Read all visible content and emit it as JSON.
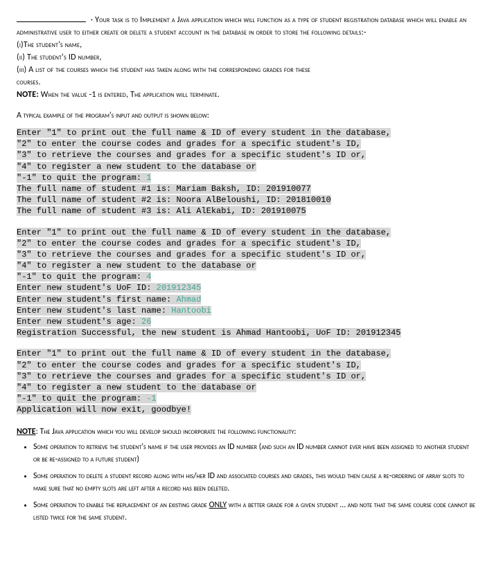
{
  "intro": {
    "line1_part1": "· Your task is to Implement a Java application which will function as a",
    "line2": "type of student registration database which will enable an administrative user to either create or delete a",
    "line3": "student account in the database in order to store the following details:-",
    "item1": "(i)The student's name,",
    "item2": "(ii) The student's ID number,",
    "item3": "(iii) A list of the courses which the student has taken along with the corresponding grades for these",
    "item3b": "courses.",
    "note_label": "NOTE:",
    "note_text": " When the value -1 is entered, The application will terminate."
  },
  "example_heading": "A typical example of the program's input and output is shown below:",
  "block1": {
    "l1": "Enter \"1\" to print out the full name & ID of every student in the database,",
    "l2": "\"2\" to enter the course codes and grades for a specific student's ID,",
    "l3": "\"3\" to retrieve the courses and grades for a specific student's ID or,",
    "l4": "\"4\" to register a new student to the database or",
    "l5a": "\"-1\" to quit the program: ",
    "l5b": "1",
    "l6": "The full name of student #1 is: Mariam Baksh, ID: 201910077",
    "l7": "The full name of student #2 is: Noora AlBeloushi, ID: 201810010",
    "l8": "The full name of student #3 is: Ali AlEkabi, ID: 201910075"
  },
  "block2": {
    "l1": "Enter \"1\" to print out the full name & ID of every student in the database,",
    "l2": "\"2\" to enter the course codes and grades for a specific student's ID,",
    "l3": "\"3\" to retrieve the courses and grades for a specific student's ID or,",
    "l4": "\"4\" to register a new student to the database or",
    "l5a": "\"-1\" to quit the program: ",
    "l5b": "4",
    "l6a": "Enter new student's UoF ID: ",
    "l6b": "201912345",
    "l7a": "Enter new student's first name: ",
    "l7b": "Ahmad",
    "l8a": "Enter new student's last name: ",
    "l8b": "Hantoobi",
    "l9a": "Enter new student's age: ",
    "l9b": "26",
    "l10": "Registration Successful, the new student is Ahmad Hantoobi, UoF ID: 201912345"
  },
  "block3": {
    "l1": "Enter \"1\" to print out the full name & ID of every student in the database,",
    "l2": "\"2\" to enter the course codes and grades for a specific student's ID,",
    "l3": "\"3\" to retrieve the courses and grades for a specific student's ID or,",
    "l4": "\"4\" to register a new student to the database or",
    "l5a": "\"-1\" to quit the program: ",
    "l5b": "-1",
    "l6": "Application will now exit, goodbye!"
  },
  "func": {
    "note_label": "NOTE",
    "note_rest": ": The Java application which you will develop should incorporate the following functionality:",
    "b1": "Some operation to retrieve the student's name if the user provides an ID number (and such an ID number cannot ever have been assigned to another student or be re-assigned to a future student)",
    "b2": "Some operation to delete a student record along with his/her ID and associated courses and grades, this would then cause a re-ordering of array slots to make sure that no empty slots are left after a record has been deleted.",
    "b3a": "Some operation to enable the replacement of an existing grade ",
    "b3only": "ONLY",
    "b3b": " with a better grade for a given student … and note that the same course code cannot be listed twice for the same student."
  }
}
